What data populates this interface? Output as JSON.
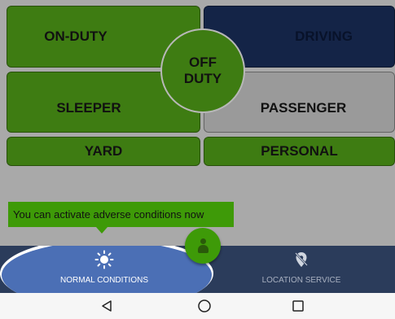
{
  "status_tiles": {
    "on_duty": "ON-DUTY",
    "driving": "DRIVING",
    "off_duty": "OFF\nDUTY",
    "sleeper": "SLEEPER",
    "passenger": "PASSENGER",
    "yard": "YARD",
    "personal": "PERSONAL"
  },
  "tooltip": {
    "text": "You can activate adverse conditions now"
  },
  "bottom_nav": {
    "normal_conditions": {
      "label": "NORMAL CONDITIONS",
      "icon": "sun-icon"
    },
    "location_service": {
      "label": "LOCATION SERVICE",
      "icon": "location-off-icon"
    },
    "fab_icon": "driver-person-icon"
  },
  "colors": {
    "active_green": "#3e7c12",
    "driving_navy": "#142447",
    "inactive_gray": "#9a9a9a",
    "tooltip_green": "#3e9a08",
    "nav_bar": "#2b3c5b",
    "highlight": "#4b6fb5"
  },
  "system_nav": {
    "back_icon": "back-triangle-icon",
    "home_icon": "home-circle-icon",
    "recents_icon": "recents-square-icon"
  }
}
